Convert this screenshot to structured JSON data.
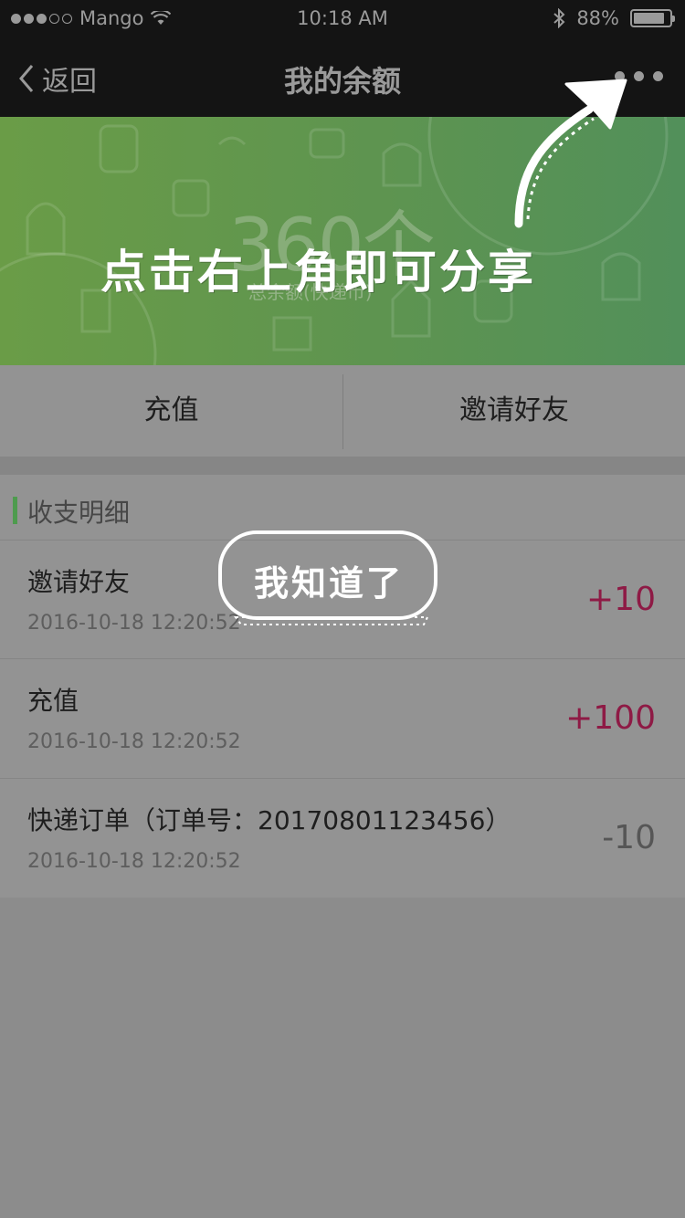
{
  "status_bar": {
    "carrier": "Mango",
    "time": "10:18 AM",
    "battery_text": "88%",
    "battery_level": 0.88,
    "signal_bars_filled": 3,
    "signal_bars_total": 5
  },
  "nav": {
    "back_label": "返回",
    "title": "我的余额"
  },
  "banner": {
    "balance_amount": "360个",
    "balance_label": "总余额(快递币)"
  },
  "actions": {
    "recharge_label": "充值",
    "invite_label": "邀请好友"
  },
  "details": {
    "title": "收支明细",
    "rows": [
      {
        "title": "邀请好友",
        "time": "2016-10-18  12:20:52",
        "amount": "+10",
        "type": "positive"
      },
      {
        "title": "充值",
        "time": "2016-10-18  12:20:52",
        "amount": "+100",
        "type": "positive"
      },
      {
        "title": "快递订单（订单号：20170801123456）",
        "time": "2016-10-18  12:20:52",
        "amount": "-10",
        "type": "negative"
      }
    ]
  },
  "overlay": {
    "hint_text": "点击右上角即可分享",
    "got_it_label": "我知道了"
  },
  "colors": {
    "positive_amount": "#8e1a45",
    "negative_amount": "#565656",
    "accent_green": "#4e9b4e",
    "banner_green": "#5e9450"
  }
}
